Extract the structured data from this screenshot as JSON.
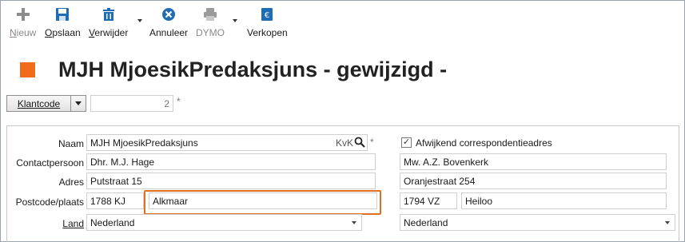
{
  "toolbar": {
    "items": [
      {
        "label": "Nieuw",
        "underline": "N",
        "rest": "ieuw",
        "icon": "plus-icon",
        "disabled": true
      },
      {
        "label": "Opslaan",
        "underline": "O",
        "rest": "pslaan",
        "icon": "save-icon",
        "disabled": false
      },
      {
        "label": "Verwijder",
        "underline": "V",
        "rest": "erwijder",
        "icon": "trash-icon",
        "disabled": false
      },
      {
        "label": "Annuleer",
        "underline": "",
        "rest": "Annuleer",
        "icon": "cancel-icon",
        "disabled": false
      },
      {
        "label": "DYMO",
        "underline": "",
        "rest": "DYMO",
        "icon": "printer-icon",
        "disabled": true
      },
      {
        "label": "Verkopen",
        "underline": "",
        "rest": "Verkopen",
        "icon": "euro-document-icon",
        "disabled": false
      }
    ]
  },
  "header": {
    "title": "MJH MjoesikPredaksjuns - gewijzigd -",
    "accent_color": "#f26a1b"
  },
  "klantcode": {
    "button_label": "Klantcode",
    "value": "2",
    "required_mark": "*"
  },
  "form": {
    "labels": {
      "naam": "Naam",
      "contactpersoon": "Contactpersoon",
      "adres": "Adres",
      "postcode_plaats": "Postcode/plaats",
      "land": "Land"
    },
    "naam": "MJH MjoesikPredaksjuns",
    "kvk_label": "KvK",
    "naam_required": "*",
    "contactpersoon": "Dhr. M.J. Hage",
    "adres": "Putstraat 15",
    "postcode": "1788 KJ",
    "plaats": "Alkmaar",
    "land": "Nederland",
    "correspondentie": {
      "checkbox_label": "Afwijkend correspondentieadres",
      "checked": true,
      "naam": "Mw. A.Z. Bovenkerk",
      "adres": "Oranjestraat 254",
      "postcode": "1794 VZ",
      "plaats": "Heiloo",
      "land": "Nederland"
    }
  },
  "highlight_color": "#e07020"
}
